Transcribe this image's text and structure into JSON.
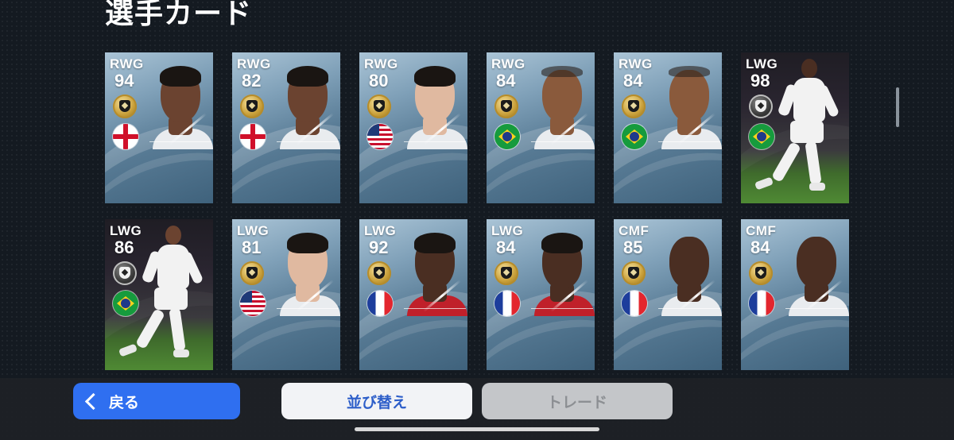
{
  "header": {
    "title": "選手カード"
  },
  "cards": [
    {
      "position": "RWG",
      "rating": "94",
      "coin": "gold",
      "flag": "england-flag",
      "style": "portrait",
      "skin": "dark",
      "hair": "full",
      "shirt": "white"
    },
    {
      "position": "RWG",
      "rating": "82",
      "coin": "gold",
      "flag": "england-flag",
      "style": "portrait",
      "skin": "dark",
      "hair": "full",
      "shirt": "white"
    },
    {
      "position": "RWG",
      "rating": "80",
      "coin": "gold",
      "flag": "usa-flag",
      "style": "portrait",
      "skin": "light",
      "hair": "full",
      "shirt": "white"
    },
    {
      "position": "RWG",
      "rating": "84",
      "coin": "gold",
      "flag": "brazil-flag",
      "style": "portrait",
      "skin": "mid",
      "hair": "thin",
      "shirt": "white"
    },
    {
      "position": "RWG",
      "rating": "84",
      "coin": "gold",
      "flag": "brazil-flag",
      "style": "portrait",
      "skin": "mid",
      "hair": "thin",
      "shirt": "white"
    },
    {
      "position": "LWG",
      "rating": "98",
      "coin": "black",
      "flag": "brazil-flag",
      "style": "action",
      "skin": "deep"
    },
    {
      "position": "LWG",
      "rating": "86",
      "coin": "black",
      "flag": "brazil-flag",
      "style": "action",
      "skin": "dark"
    },
    {
      "position": "LWG",
      "rating": "81",
      "coin": "gold",
      "flag": "usa-flag",
      "style": "portrait",
      "skin": "light",
      "hair": "full",
      "shirt": "white"
    },
    {
      "position": "LWG",
      "rating": "92",
      "coin": "gold",
      "flag": "france-flag",
      "style": "portrait",
      "skin": "deep",
      "hair": "full",
      "shirt": "red"
    },
    {
      "position": "LWG",
      "rating": "84",
      "coin": "gold",
      "flag": "france-flag",
      "style": "portrait",
      "skin": "deep",
      "hair": "full",
      "shirt": "red"
    },
    {
      "position": "CMF",
      "rating": "85",
      "coin": "gold",
      "flag": "france-flag",
      "style": "portrait",
      "skin": "deep",
      "hair": "none",
      "shirt": "white"
    },
    {
      "position": "CMF",
      "rating": "84",
      "coin": "gold",
      "flag": "france-flag",
      "style": "portrait",
      "skin": "deep",
      "hair": "none",
      "shirt": "white"
    }
  ],
  "footer": {
    "back_label": "戻る",
    "sort_label": "並び替え",
    "trade_label": "トレード"
  },
  "colors": {
    "back_button": "#2f6ff0",
    "sort_text": "#2d5ec9",
    "trade_disabled": "#c4c6c9"
  }
}
